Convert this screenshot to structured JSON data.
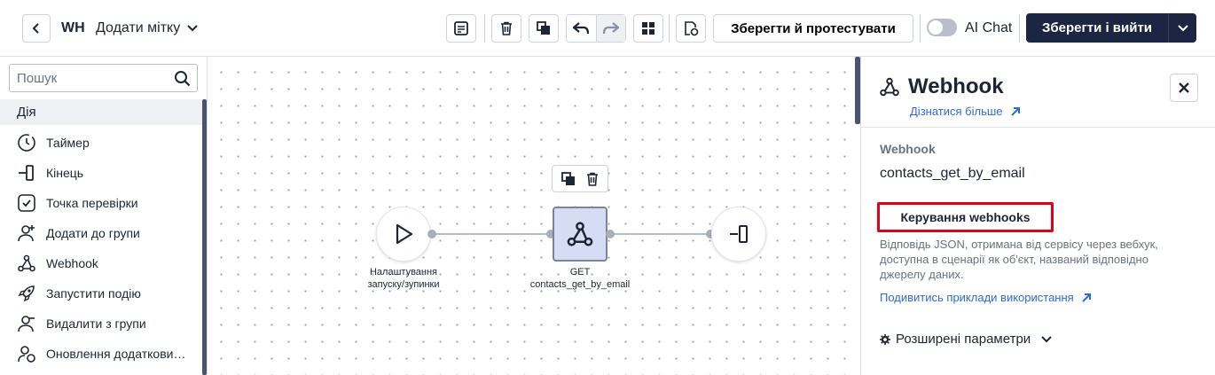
{
  "header": {
    "abbr": "WH",
    "title": "Додати мітку",
    "save_test_label": "Зберегти й протестувати",
    "ai_chat_label": "AI Chat",
    "save_exit_label": "Зберегти і вийти"
  },
  "sidebar": {
    "search_placeholder": "Пошук",
    "category": "Дія",
    "items": [
      {
        "label": "Таймер",
        "icon": "timer-icon"
      },
      {
        "label": "Кінець",
        "icon": "end-icon"
      },
      {
        "label": "Точка перевірки",
        "icon": "checkpoint-icon"
      },
      {
        "label": "Додати до групи",
        "icon": "add-group-icon"
      },
      {
        "label": "Webhook",
        "icon": "webhook-icon"
      },
      {
        "label": "Запустити подію",
        "icon": "rocket-icon"
      },
      {
        "label": "Видалити з групи",
        "icon": "remove-group-icon"
      },
      {
        "label": "Оновлення додаткови…",
        "icon": "update-attributes-icon"
      }
    ]
  },
  "canvas": {
    "start_label": "Налаштування запуску/зупинки",
    "webhook_method": "GET",
    "webhook_name": "contacts_get_by_email"
  },
  "panel": {
    "title": "Webhook",
    "learn_more": "Дізнатися більше",
    "field_label": "Webhook",
    "field_value": "contacts_get_by_email",
    "manage_button": "Керування webhooks",
    "description": "Відповідь JSON, отримана від сервісу через вебхук, доступна в сценарії як об'єкт, названий відповідно джерелу даних.",
    "examples_link": "Подивитись приклади використання",
    "advanced_label": "Розширені параметри"
  },
  "colors": {
    "primary_dark": "#1c2541",
    "link_blue": "#2f6bd6",
    "highlight_red": "#e0001a",
    "selected_node": "#d5dcf3"
  }
}
